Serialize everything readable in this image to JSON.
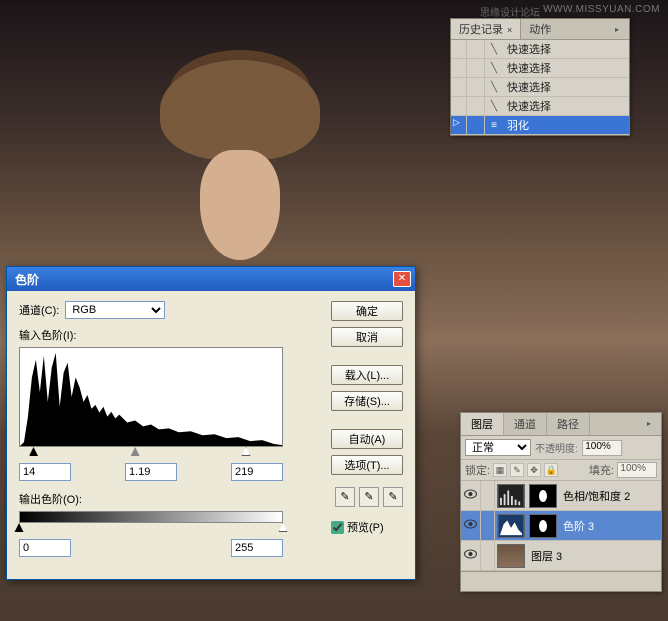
{
  "watermark_main": "WWW.MISSYUAN.COM",
  "watermark_sub": "思缘设计论坛",
  "history": {
    "tabs": {
      "history": "历史记录",
      "actions": "动作"
    },
    "items": [
      {
        "label": "快速选择",
        "icon": "wand",
        "selected": false
      },
      {
        "label": "快速选择",
        "icon": "wand",
        "selected": false
      },
      {
        "label": "快速选择",
        "icon": "wand",
        "selected": false
      },
      {
        "label": "快速选择",
        "icon": "wand",
        "selected": false
      },
      {
        "label": "羽化",
        "icon": "feather",
        "selected": true
      }
    ]
  },
  "levels": {
    "title": "色阶",
    "channel_label": "通道(C):",
    "channel_value": "RGB",
    "input_label": "输入色阶(I):",
    "output_label": "输出色阶(O):",
    "input_black": "14",
    "input_gamma": "1.19",
    "input_white": "219",
    "output_black": "0",
    "output_white": "255",
    "buttons": {
      "ok": "确定",
      "cancel": "取消",
      "load": "载入(L)...",
      "save": "存储(S)...",
      "auto": "自动(A)",
      "options": "选项(T)..."
    },
    "preview_label": "预览(P)"
  },
  "layers": {
    "tabs": {
      "layers": "图层",
      "channels": "通道",
      "paths": "路径"
    },
    "blend_mode": "正常",
    "opacity_label": "不透明度:",
    "opacity_value": "100%",
    "lock_label": "锁定:",
    "fill_label": "填充:",
    "fill_value": "100%",
    "items": [
      {
        "name": "色相/饱和度 2",
        "type": "adjustment",
        "selected": false,
        "has_mask": true
      },
      {
        "name": "色阶 3",
        "type": "levels",
        "selected": true,
        "has_mask": true
      },
      {
        "name": "图层 3",
        "type": "image",
        "selected": false,
        "has_mask": false
      }
    ]
  },
  "chart_data": {
    "type": "histogram",
    "title": "输入色阶",
    "xlabel": "",
    "ylabel": "",
    "xlim": [
      0,
      255
    ],
    "note": "Image luminance histogram; tall spikes concentrated in shadows/low-mids (approx 10–70), tapering tail toward highlights; few near-white pixels.",
    "sliders": {
      "black": 14,
      "gamma": 1.19,
      "white": 219
    },
    "output_range": [
      0,
      255
    ]
  }
}
